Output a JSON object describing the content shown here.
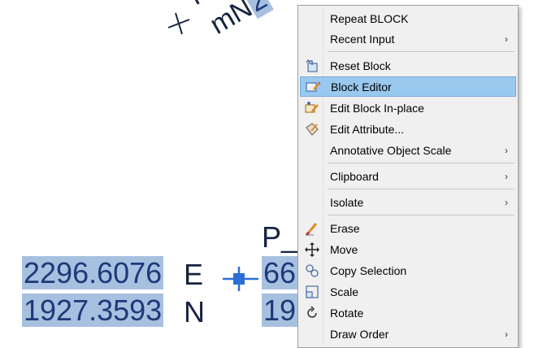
{
  "canvas": {
    "top_annotation": {
      "line1_text": "m",
      "line2_prefix": "mN",
      "line2_highlight": "2"
    },
    "point_label": "P_",
    "easting": {
      "value": "2296.6076",
      "suffix": "E",
      "right_value": "66"
    },
    "northing": {
      "value": "1927.3593",
      "suffix": "N",
      "right_value": "19"
    },
    "colors": {
      "text": "#15243f",
      "highlight": "#a8c0e0",
      "grip": "#2b6fd6"
    }
  },
  "menu": {
    "items": [
      {
        "label": "Repeat BLOCK",
        "icon": "none",
        "submenu": false
      },
      {
        "label": "Recent Input",
        "icon": "none",
        "submenu": true
      },
      {
        "label": "Reset Block",
        "icon": "reset-block-icon",
        "submenu": false
      },
      {
        "label": "Block Editor",
        "icon": "block-editor-icon",
        "submenu": false,
        "active": true
      },
      {
        "label": "Edit Block In-place",
        "icon": "edit-block-in-place-icon",
        "submenu": false
      },
      {
        "label": "Edit Attribute...",
        "icon": "edit-attribute-icon",
        "submenu": false
      },
      {
        "label": "Annotative Object Scale",
        "icon": "none",
        "submenu": true
      },
      {
        "label": "Clipboard",
        "icon": "none",
        "submenu": true
      },
      {
        "label": "Isolate",
        "icon": "none",
        "submenu": true
      },
      {
        "label": "Erase",
        "icon": "erase-icon",
        "submenu": false
      },
      {
        "label": "Move",
        "icon": "move-icon",
        "submenu": false
      },
      {
        "label": "Copy Selection",
        "icon": "copy-selection-icon",
        "submenu": false
      },
      {
        "label": "Scale",
        "icon": "scale-icon",
        "submenu": false
      },
      {
        "label": "Rotate",
        "icon": "rotate-icon",
        "submenu": false
      },
      {
        "label": "Draw Order",
        "icon": "none",
        "submenu": true
      }
    ],
    "submenu_arrow": "›",
    "active_color": "#99c9ef"
  }
}
